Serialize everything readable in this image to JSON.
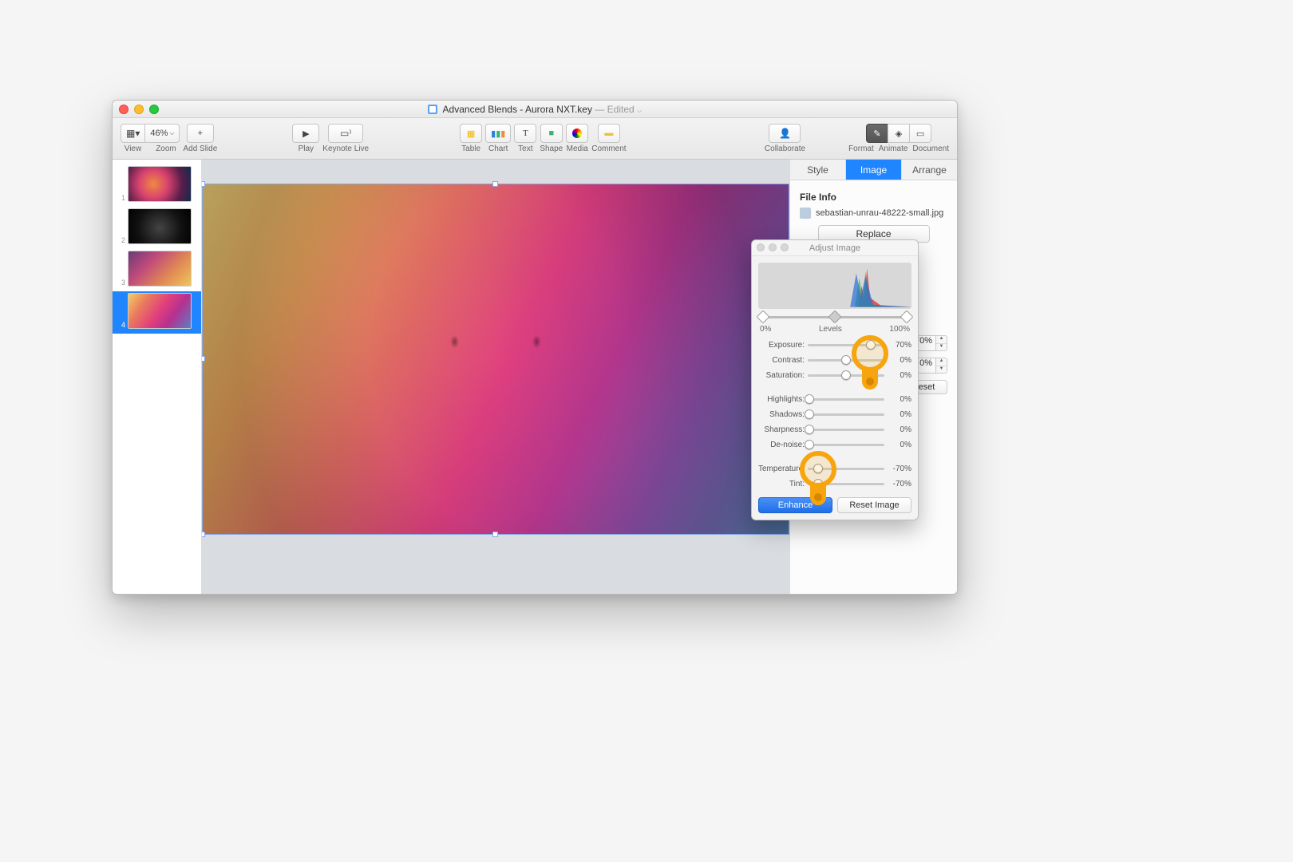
{
  "window": {
    "title": "Advanced Blends - Aurora NXT.key",
    "status": "Edited"
  },
  "toolbar": {
    "view": "View",
    "zoom_value": "46%",
    "zoom": "Zoom",
    "add_slide_glyph": "+",
    "add_slide": "Add Slide",
    "play_glyph": "▶",
    "play": "Play",
    "keynote_live": "Keynote Live",
    "table": "Table",
    "chart": "Chart",
    "text_glyph": "T",
    "text": "Text",
    "shape": "Shape",
    "media": "Media",
    "comment": "Comment",
    "collaborate": "Collaborate",
    "format": "Format",
    "animate": "Animate",
    "document": "Document"
  },
  "slides": {
    "numbers": [
      "1",
      "2",
      "3",
      "4"
    ],
    "selected_index": 3
  },
  "inspector": {
    "tabs": {
      "style": "Style",
      "image": "Image",
      "arrange": "Arrange"
    },
    "file_info_header": "File Info",
    "filename": "sebastian-unrau-48222-small.jpg",
    "replace": "Replace",
    "exposure_value": "70%",
    "saturation_value": "0%",
    "reset": "Reset"
  },
  "adjust": {
    "title": "Adjust Image",
    "levels_label": "Levels",
    "levels_min": "0%",
    "levels_max": "100%",
    "rows": {
      "exposure": {
        "label": "Exposure:",
        "value": "70%",
        "pos": 82
      },
      "contrast": {
        "label": "Contrast:",
        "value": "0%",
        "pos": 50
      },
      "saturation": {
        "label": "Saturation:",
        "value": "0%",
        "pos": 50
      },
      "highlights": {
        "label": "Highlights:",
        "value": "0%",
        "pos": 2
      },
      "shadows": {
        "label": "Shadows:",
        "value": "0%",
        "pos": 2
      },
      "sharpness": {
        "label": "Sharpness:",
        "value": "0%",
        "pos": 2
      },
      "denoise": {
        "label": "De-noise:",
        "value": "0%",
        "pos": 2
      },
      "temperature": {
        "label": "Temperature:",
        "value": "-70%",
        "pos": 14
      },
      "tint": {
        "label": "Tint:",
        "value": "-70%",
        "pos": 14
      }
    },
    "enhance": "Enhance",
    "reset_image": "Reset Image"
  }
}
